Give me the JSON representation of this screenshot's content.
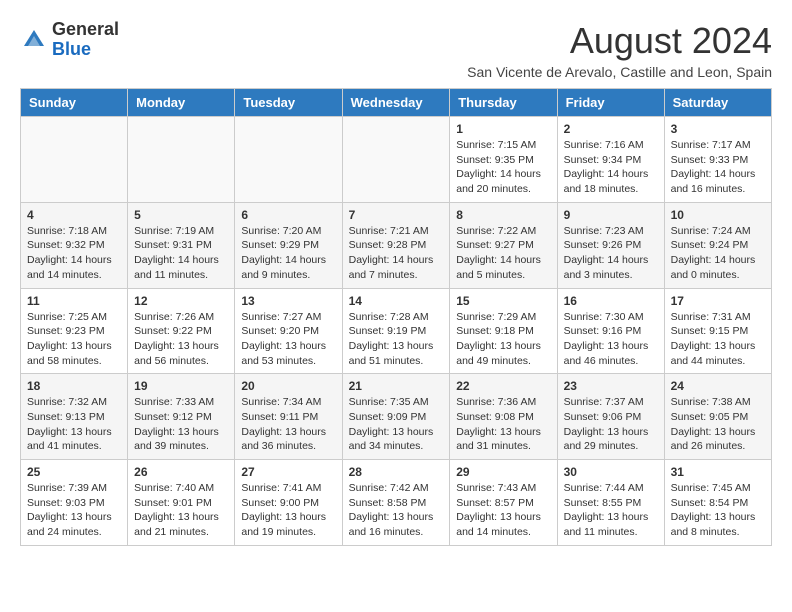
{
  "logo": {
    "general": "General",
    "blue": "Blue"
  },
  "title": "August 2024",
  "subtitle": "San Vicente de Arevalo, Castille and Leon, Spain",
  "days_of_week": [
    "Sunday",
    "Monday",
    "Tuesday",
    "Wednesday",
    "Thursday",
    "Friday",
    "Saturday"
  ],
  "weeks": [
    [
      {
        "day": "",
        "info": ""
      },
      {
        "day": "",
        "info": ""
      },
      {
        "day": "",
        "info": ""
      },
      {
        "day": "",
        "info": ""
      },
      {
        "day": "1",
        "info": "Sunrise: 7:15 AM\nSunset: 9:35 PM\nDaylight: 14 hours\nand 20 minutes."
      },
      {
        "day": "2",
        "info": "Sunrise: 7:16 AM\nSunset: 9:34 PM\nDaylight: 14 hours\nand 18 minutes."
      },
      {
        "day": "3",
        "info": "Sunrise: 7:17 AM\nSunset: 9:33 PM\nDaylight: 14 hours\nand 16 minutes."
      }
    ],
    [
      {
        "day": "4",
        "info": "Sunrise: 7:18 AM\nSunset: 9:32 PM\nDaylight: 14 hours\nand 14 minutes."
      },
      {
        "day": "5",
        "info": "Sunrise: 7:19 AM\nSunset: 9:31 PM\nDaylight: 14 hours\nand 11 minutes."
      },
      {
        "day": "6",
        "info": "Sunrise: 7:20 AM\nSunset: 9:29 PM\nDaylight: 14 hours\nand 9 minutes."
      },
      {
        "day": "7",
        "info": "Sunrise: 7:21 AM\nSunset: 9:28 PM\nDaylight: 14 hours\nand 7 minutes."
      },
      {
        "day": "8",
        "info": "Sunrise: 7:22 AM\nSunset: 9:27 PM\nDaylight: 14 hours\nand 5 minutes."
      },
      {
        "day": "9",
        "info": "Sunrise: 7:23 AM\nSunset: 9:26 PM\nDaylight: 14 hours\nand 3 minutes."
      },
      {
        "day": "10",
        "info": "Sunrise: 7:24 AM\nSunset: 9:24 PM\nDaylight: 14 hours\nand 0 minutes."
      }
    ],
    [
      {
        "day": "11",
        "info": "Sunrise: 7:25 AM\nSunset: 9:23 PM\nDaylight: 13 hours\nand 58 minutes."
      },
      {
        "day": "12",
        "info": "Sunrise: 7:26 AM\nSunset: 9:22 PM\nDaylight: 13 hours\nand 56 minutes."
      },
      {
        "day": "13",
        "info": "Sunrise: 7:27 AM\nSunset: 9:20 PM\nDaylight: 13 hours\nand 53 minutes."
      },
      {
        "day": "14",
        "info": "Sunrise: 7:28 AM\nSunset: 9:19 PM\nDaylight: 13 hours\nand 51 minutes."
      },
      {
        "day": "15",
        "info": "Sunrise: 7:29 AM\nSunset: 9:18 PM\nDaylight: 13 hours\nand 49 minutes."
      },
      {
        "day": "16",
        "info": "Sunrise: 7:30 AM\nSunset: 9:16 PM\nDaylight: 13 hours\nand 46 minutes."
      },
      {
        "day": "17",
        "info": "Sunrise: 7:31 AM\nSunset: 9:15 PM\nDaylight: 13 hours\nand 44 minutes."
      }
    ],
    [
      {
        "day": "18",
        "info": "Sunrise: 7:32 AM\nSunset: 9:13 PM\nDaylight: 13 hours\nand 41 minutes."
      },
      {
        "day": "19",
        "info": "Sunrise: 7:33 AM\nSunset: 9:12 PM\nDaylight: 13 hours\nand 39 minutes."
      },
      {
        "day": "20",
        "info": "Sunrise: 7:34 AM\nSunset: 9:11 PM\nDaylight: 13 hours\nand 36 minutes."
      },
      {
        "day": "21",
        "info": "Sunrise: 7:35 AM\nSunset: 9:09 PM\nDaylight: 13 hours\nand 34 minutes."
      },
      {
        "day": "22",
        "info": "Sunrise: 7:36 AM\nSunset: 9:08 PM\nDaylight: 13 hours\nand 31 minutes."
      },
      {
        "day": "23",
        "info": "Sunrise: 7:37 AM\nSunset: 9:06 PM\nDaylight: 13 hours\nand 29 minutes."
      },
      {
        "day": "24",
        "info": "Sunrise: 7:38 AM\nSunset: 9:05 PM\nDaylight: 13 hours\nand 26 minutes."
      }
    ],
    [
      {
        "day": "25",
        "info": "Sunrise: 7:39 AM\nSunset: 9:03 PM\nDaylight: 13 hours\nand 24 minutes."
      },
      {
        "day": "26",
        "info": "Sunrise: 7:40 AM\nSunset: 9:01 PM\nDaylight: 13 hours\nand 21 minutes."
      },
      {
        "day": "27",
        "info": "Sunrise: 7:41 AM\nSunset: 9:00 PM\nDaylight: 13 hours\nand 19 minutes."
      },
      {
        "day": "28",
        "info": "Sunrise: 7:42 AM\nSunset: 8:58 PM\nDaylight: 13 hours\nand 16 minutes."
      },
      {
        "day": "29",
        "info": "Sunrise: 7:43 AM\nSunset: 8:57 PM\nDaylight: 13 hours\nand 14 minutes."
      },
      {
        "day": "30",
        "info": "Sunrise: 7:44 AM\nSunset: 8:55 PM\nDaylight: 13 hours\nand 11 minutes."
      },
      {
        "day": "31",
        "info": "Sunrise: 7:45 AM\nSunset: 8:54 PM\nDaylight: 13 hours\nand 8 minutes."
      }
    ]
  ]
}
